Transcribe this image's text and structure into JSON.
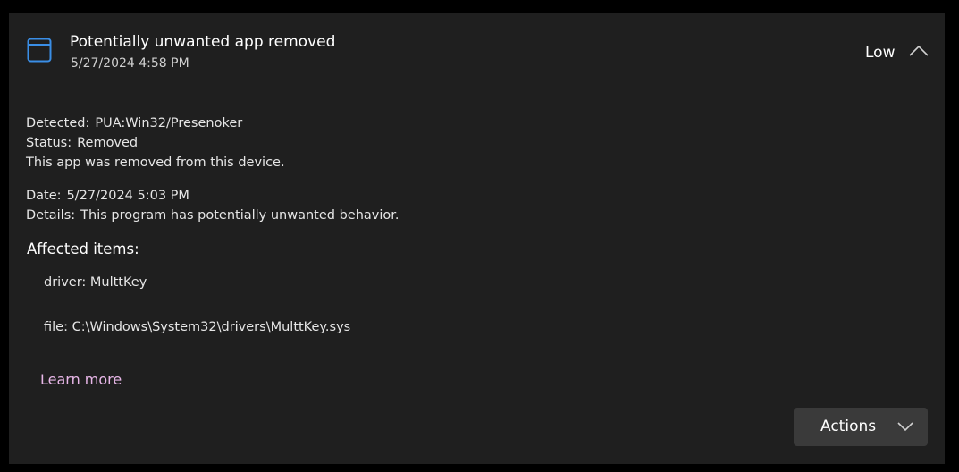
{
  "header": {
    "title": "Potentially unwanted app removed",
    "date": "5/27/2024 4:58 PM",
    "severity": "Low",
    "icon": "app-window-icon",
    "collapse_icon": "chevron-up-icon"
  },
  "details": {
    "detected_label": "Detected:",
    "detected_value": "PUA:Win32/Presenoker",
    "status_label": "Status:",
    "status_value": "Removed",
    "status_note": "This app was removed from this device.",
    "date_label": "Date:",
    "date_value": "5/27/2024 5:03 PM",
    "details_label": "Details:",
    "details_value": "This program has potentially unwanted behavior."
  },
  "affected": {
    "title": "Affected items:",
    "items": [
      "driver: MulttKey",
      "file: C:\\Windows\\System32\\drivers\\MulttKey.sys"
    ]
  },
  "learn_more": "Learn more",
  "actions": {
    "label": "Actions",
    "icon": "chevron-down-icon"
  },
  "colors": {
    "background": "#000000",
    "card": "#1f1f1f",
    "accent_icon": "#3a8ee6",
    "link": "#e8b7e8",
    "button": "#3a3a3a"
  }
}
